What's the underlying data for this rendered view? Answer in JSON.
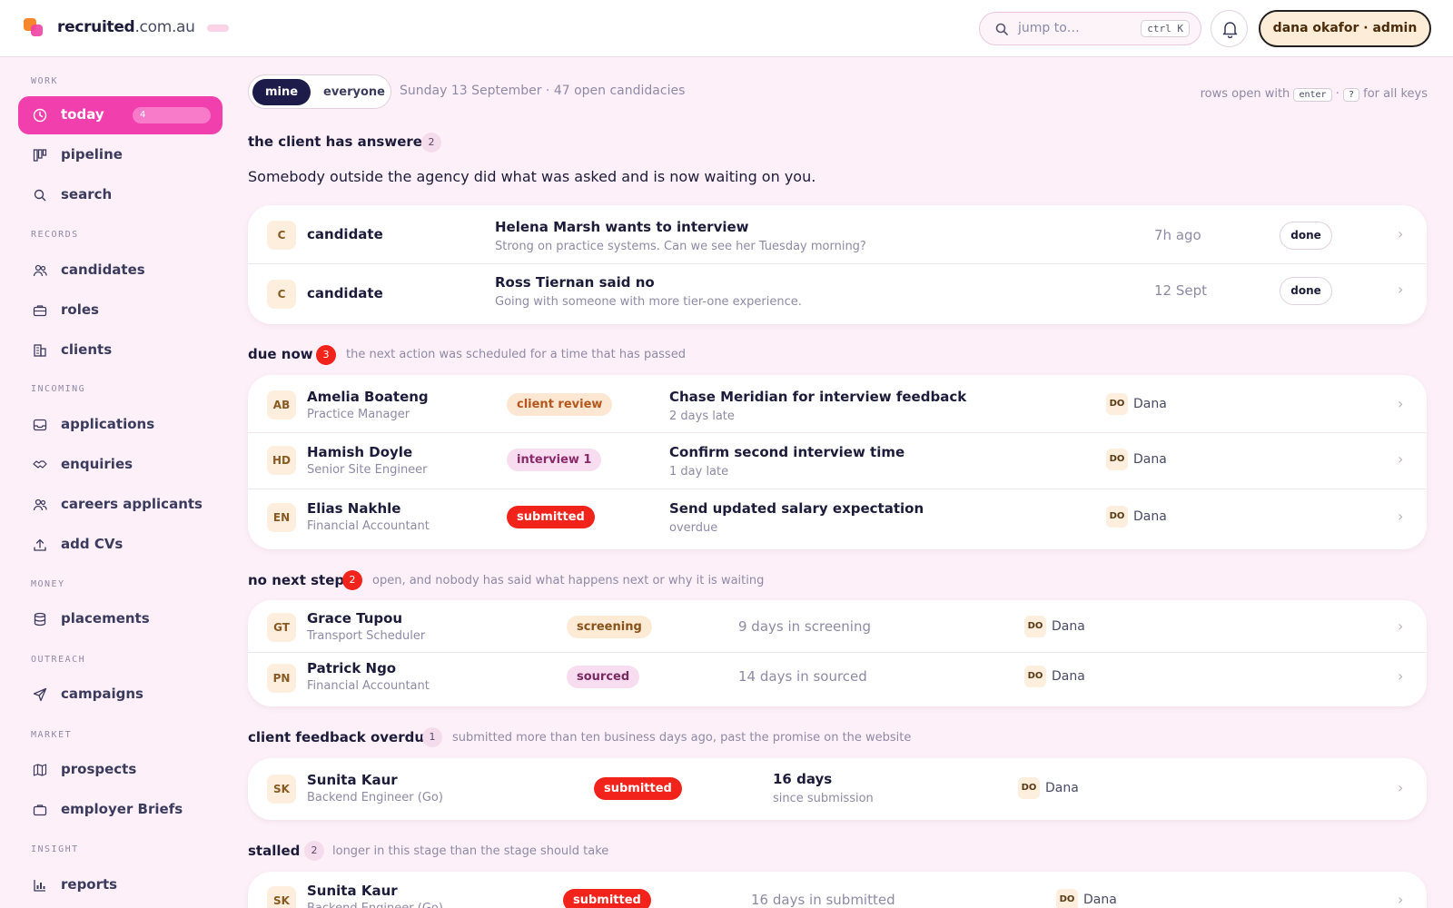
{
  "brand": {
    "name_bold": "recruited",
    "name_rest": ".com.au"
  },
  "header": {
    "search_placeholder": "jump to…",
    "search_shortcut": "ctrl K",
    "user_label": "dana okafor · admin"
  },
  "sidebar": {
    "sections": [
      "WORK",
      "RECORDS",
      "INCOMING",
      "MONEY",
      "OUTREACH",
      "MARKET",
      "INSIGHT"
    ],
    "items": [
      {
        "label": "today",
        "icon": "clock-icon",
        "badge": "4"
      },
      {
        "label": "pipeline",
        "icon": "kanban-icon"
      },
      {
        "label": "search",
        "icon": "search-icon"
      },
      {
        "label": "candidates",
        "icon": "users-icon"
      },
      {
        "label": "roles",
        "icon": "briefcase-icon"
      },
      {
        "label": "clients",
        "icon": "building-icon"
      },
      {
        "label": "applications",
        "icon": "inbox-icon"
      },
      {
        "label": "enquiries",
        "icon": "handshake-icon"
      },
      {
        "label": "careers applicants",
        "icon": "users-icon"
      },
      {
        "label": "add CVs",
        "icon": "upload-icon"
      },
      {
        "label": "placements",
        "icon": "database-icon"
      },
      {
        "label": "campaigns",
        "icon": "send-icon"
      },
      {
        "label": "prospects",
        "icon": "map-icon"
      },
      {
        "label": "employer Briefs",
        "icon": "briefcase-icon"
      },
      {
        "label": "reports",
        "icon": "bar-chart-icon"
      }
    ]
  },
  "filter": {
    "mine": "mine",
    "everyone": "everyone"
  },
  "date_info": "Sunday 13 September · 47 open candidacies",
  "keys_hint": {
    "pre": "rows open with",
    "enter": "enter",
    "dot": "·",
    "q": "?",
    "post": "for all keys"
  },
  "groups": {
    "answered": {
      "title": "the client has answered",
      "count": "2",
      "subline": "Somebody outside the agency did what was asked and is now waiting on you.",
      "rows": [
        {
          "initial": "C",
          "kind": "candidate",
          "title": "Helena Marsh wants to interview",
          "message": "Strong on practice systems. Can we see her Tuesday morning?",
          "when": "7h ago",
          "action": "done"
        },
        {
          "initial": "C",
          "kind": "candidate",
          "title": "Ross Tiernan said no",
          "message": "Going with someone with more tier-one experience.",
          "when": "12 Sept",
          "action": "done"
        }
      ]
    },
    "due_now": {
      "title": "due now",
      "count": "3",
      "desc": "the next action was scheduled for a time that has passed",
      "rows": [
        {
          "initials": "AB",
          "name": "Amelia Boateng",
          "role": "Practice Manager",
          "stage": "client review",
          "task": "Chase Meridian for interview feedback",
          "late": "2 days late",
          "owner_initials": "DO",
          "owner": "Dana"
        },
        {
          "initials": "HD",
          "name": "Hamish Doyle",
          "role": "Senior Site Engineer",
          "stage": "interview 1",
          "task": "Confirm second interview time",
          "late": "1 day late",
          "owner_initials": "DO",
          "owner": "Dana"
        },
        {
          "initials": "EN",
          "name": "Elias Nakhle",
          "role": "Financial Accountant",
          "stage": "submitted",
          "task": "Send updated salary expectation",
          "late": "overdue",
          "owner_initials": "DO",
          "owner": "Dana"
        }
      ]
    },
    "no_next": {
      "title": "no next step",
      "count": "2",
      "desc": "open, and nobody has said what happens next or why it is waiting",
      "rows": [
        {
          "initials": "GT",
          "name": "Grace Tupou",
          "role": "Transport Scheduler",
          "stage": "screening",
          "age": "9 days in screening",
          "owner_initials": "DO",
          "owner": "Dana"
        },
        {
          "initials": "PN",
          "name": "Patrick Ngo",
          "role": "Financial Accountant",
          "stage": "sourced",
          "age": "14 days in sourced",
          "owner_initials": "DO",
          "owner": "Dana"
        }
      ]
    },
    "feedback": {
      "title": "client feedback overdue",
      "count": "1",
      "desc": "submitted more than ten business days ago, past the promise on the website",
      "rows": [
        {
          "initials": "SK",
          "name": "Sunita Kaur",
          "role": "Backend Engineer (Go)",
          "stage": "submitted",
          "days": "16 days",
          "since": "since submission",
          "owner_initials": "DO",
          "owner": "Dana"
        }
      ]
    },
    "stalled": {
      "title": "stalled",
      "count": "2",
      "desc": "longer in this stage than the stage should take",
      "rows": [
        {
          "initials": "SK",
          "name": "Sunita Kaur",
          "role": "Backend Engineer (Go)",
          "stage": "submitted",
          "age": "16 days in submitted",
          "owner_initials": "DO",
          "owner": "Dana"
        }
      ]
    }
  },
  "colors": {
    "accent": "#f23fae",
    "navy": "#1c1b4a",
    "alert": "#f2231a",
    "bg": "#fdf0f8"
  }
}
